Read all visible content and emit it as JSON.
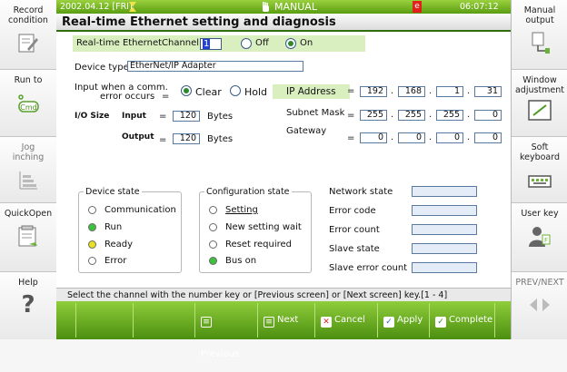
{
  "left_sidebar": [
    {
      "label": "Record\ncondition",
      "icon": "record-condition-icon"
    },
    {
      "label": "Run to",
      "icon": "cmd-icon",
      "icon_text": "Cmd"
    },
    {
      "label": "Jog\ninching",
      "icon": "jog-inching-icon"
    },
    {
      "label": "QuickOpen",
      "icon": "quick-open-icon"
    },
    {
      "label": "Help",
      "icon": "help-icon",
      "icon_text": "?"
    }
  ],
  "right_sidebar": [
    {
      "label": "Manual\noutput",
      "icon": "manual-output-icon"
    },
    {
      "label": "Window\nadjustment",
      "icon": "window-adjustment-icon"
    },
    {
      "label": "Soft\nkeyboard",
      "icon": "soft-keyboard-icon"
    },
    {
      "label": "User key",
      "icon": "user-key-icon"
    },
    {
      "label": "PREV/NEXT",
      "icon": "prev-next-icon"
    }
  ],
  "topbar": {
    "date": "2002.04.12 [FRI]",
    "mode": "MANUAL",
    "badge": "e",
    "time": "06:07:12 PM"
  },
  "title": "Real-time Ethernet setting and diagnosis",
  "channel_row": {
    "label": "Real-time Ethernet",
    "channel_label": "Channel",
    "channel_value": "1",
    "off_label": "Off",
    "on_label": "On",
    "selected": "On"
  },
  "device_type": {
    "label": "Device type",
    "value": "EtherNet/IP Adapter"
  },
  "comm_error": {
    "label_line1": "Input when a comm.",
    "label_line2": "error occurs",
    "eq": "=",
    "clear_label": "Clear",
    "hold_label": "Hold",
    "selected": "Clear"
  },
  "io_size": {
    "label": "I/O Size",
    "input_label": "Input",
    "input_value": "120",
    "output_label": "Output",
    "output_value": "120",
    "unit": "Bytes",
    "eq": "="
  },
  "network": {
    "ip_label": "IP Address",
    "ip": [
      "192",
      "168",
      "1",
      "31"
    ],
    "subnet_label": "Subnet Mask",
    "subnet": [
      "255",
      "255",
      "255",
      "0"
    ],
    "gateway_label": "Gateway",
    "gateway": [
      "0",
      "0",
      "0",
      "0"
    ],
    "eq": "=",
    "dot": "."
  },
  "device_state": {
    "title": "Device state",
    "items": [
      {
        "label": "Communication",
        "state": "off"
      },
      {
        "label": "Run",
        "state": "green"
      },
      {
        "label": "Ready",
        "state": "yellow"
      },
      {
        "label": "Error",
        "state": "off"
      }
    ]
  },
  "config_state": {
    "title": "Configuration state",
    "items": [
      {
        "label": "Setting",
        "state": "off"
      },
      {
        "label": "New setting wait",
        "state": "off"
      },
      {
        "label": "Reset required",
        "state": "off"
      },
      {
        "label": "Bus on",
        "state": "green"
      }
    ]
  },
  "net_status": [
    {
      "label": "Network state",
      "value": ""
    },
    {
      "label": "Error code",
      "value": ""
    },
    {
      "label": "Error count",
      "value": ""
    },
    {
      "label": "Slave state",
      "value": ""
    },
    {
      "label": "Slave error count",
      "value": ""
    }
  ],
  "status_message": "Select the channel with the number key or [Previous screen] or [Next screen] key.[1 - 4]",
  "buttons": {
    "previous": "Previous",
    "next": "Next",
    "cancel": "Cancel",
    "apply": "Apply",
    "complete": "Complete"
  },
  "colors": {
    "green_bar": "#5a9d12",
    "title_line": "#2f6e0d",
    "channel_bg": "#d9efbf",
    "field_border": "#5a7aa0"
  }
}
